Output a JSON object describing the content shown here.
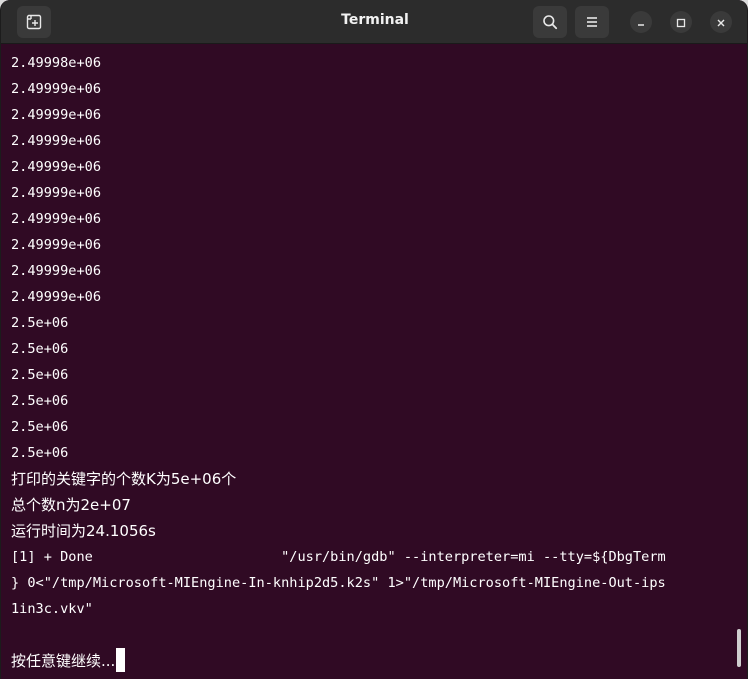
{
  "window": {
    "title": "Terminal"
  },
  "toolbar": {
    "new_tab_icon": "new-tab-icon",
    "search_icon": "search-icon",
    "menu_icon": "hamburger-menu-icon"
  },
  "window_controls": {
    "minimize_icon": "minimize-icon",
    "maximize_icon": "maximize-icon",
    "close_icon": "close-icon"
  },
  "terminal": {
    "lines": [
      "2.49998e+06",
      "2.49999e+06",
      "2.49999e+06",
      "2.49999e+06",
      "2.49999e+06",
      "2.49999e+06",
      "2.49999e+06",
      "2.49999e+06",
      "2.49999e+06",
      "2.49999e+06",
      "2.5e+06",
      "2.5e+06",
      "2.5e+06",
      "2.5e+06",
      "2.5e+06",
      "2.5e+06",
      "打印的关键字的个数K为5e+06个",
      "总个数n为2e+07",
      "运行时间为24.1056s",
      "[1] + Done                       \"/usr/bin/gdb\" --interpreter=mi --tty=${DbgTerm",
      "} 0<\"/tmp/Microsoft-MIEngine-In-knhip2d5.k2s\" 1>\"/tmp/Microsoft-MIEngine-Out-ips",
      "1in3c.vkv\"",
      "",
      "按任意键继续..."
    ]
  },
  "colors": {
    "terminal_background": "#300a24",
    "titlebar_background": "#2c2c2c",
    "text": "#ffffff"
  }
}
